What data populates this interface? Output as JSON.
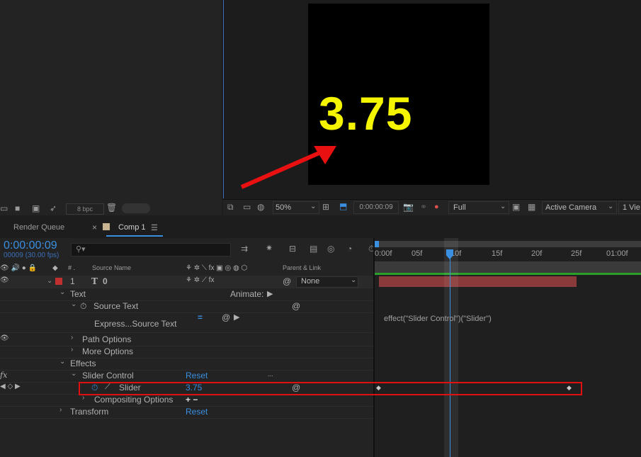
{
  "project_bottom": {
    "bpc_label": "8 bpc"
  },
  "viewer": {
    "displayed_value": "3.75",
    "zoom": "50%",
    "timecode": "0:00:00:09",
    "resolution": "Full",
    "camera": "Active Camera",
    "views": "1 Vie"
  },
  "tabs": {
    "render_queue": "Render Queue",
    "comp": "Comp 1",
    "close_glyph": "×",
    "menu_glyph": "☰"
  },
  "timeline": {
    "current_time": "0:00:00:09",
    "frame_info": "00009 (30.00 fps)",
    "search_placeholder": "",
    "headers": {
      "source_name": "Source Name",
      "parent_link": "Parent & Link"
    },
    "ruler": [
      "0:00f",
      "05f",
      "10f",
      "15f",
      "20f",
      "25f",
      "01:00f"
    ],
    "layer": {
      "number": "1",
      "type_glyph": "T",
      "name": "0",
      "parent": "None"
    },
    "rows": {
      "text": "Text",
      "animate": "Animate:",
      "source_text": "Source Text",
      "expression": "Express...Source Text",
      "path_options": "Path Options",
      "more_options": "More Options",
      "effects": "Effects",
      "slider_control": "Slider Control",
      "slider_control_reset": "Reset",
      "slider_control_dots": "...",
      "slider": "Slider",
      "slider_value": "3.75",
      "compositing_options": "Compositing Options",
      "compositing_add": "+ −",
      "transform": "Transform",
      "transform_reset": "Reset",
      "fx_label": "fx"
    },
    "expression_text": "effect(\"Slider Control\")(\"Slider\")",
    "colors": {
      "accent": "#3a8fe0",
      "layer_bar": "#8a3a3a",
      "label_red": "#c03030",
      "highlight": "#e01010",
      "green": "#2aa02a"
    }
  }
}
